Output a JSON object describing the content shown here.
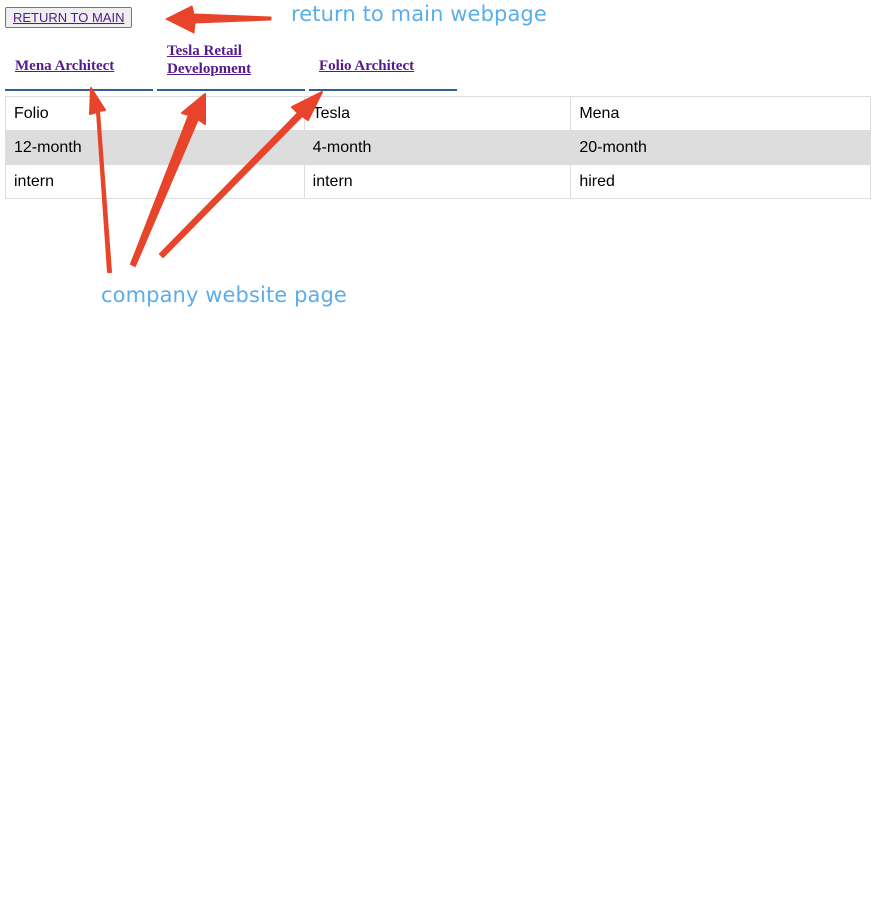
{
  "header": {
    "return_button_label": "RETURN TO MAIN"
  },
  "companies": {
    "links": [
      {
        "label": "Mena Architect"
      },
      {
        "label": "Tesla Retail Development"
      },
      {
        "label": "Folio Architect"
      }
    ]
  },
  "table": {
    "rows": [
      [
        "Folio",
        "Tesla",
        "Mena"
      ],
      [
        "12-month",
        "4-month",
        "20-month"
      ],
      [
        "intern",
        "intern",
        "hired"
      ]
    ]
  },
  "annotations": {
    "return_note": "return to main webpage",
    "company_note": "company website page"
  },
  "colors": {
    "annotation_arrow": "#e8442b",
    "annotation_text": "#5aaeea",
    "link_visited": "#551a8b",
    "link_underline_bar": "#2f5f96",
    "shaded_row": "#dddddd"
  }
}
